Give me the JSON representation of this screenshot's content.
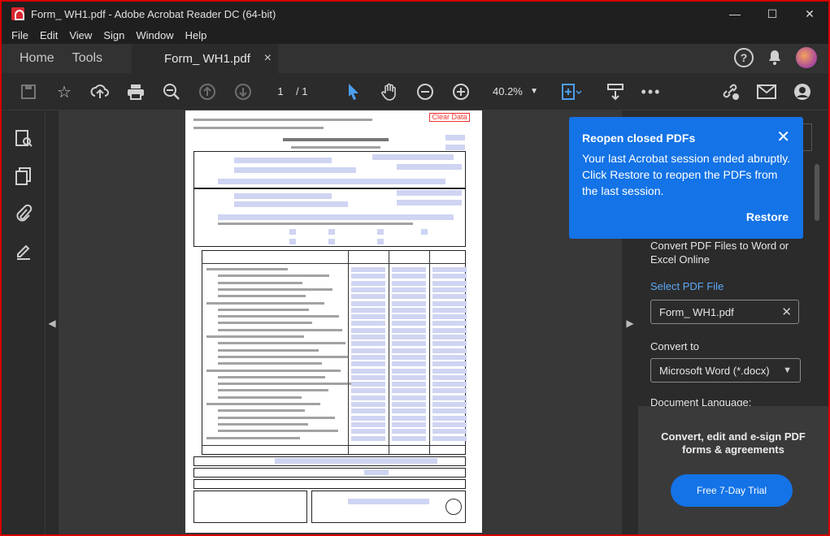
{
  "window": {
    "title": "Form_ WH1.pdf - Adobe Acrobat Reader DC (64-bit)",
    "min_glyph": "—",
    "max_glyph": "☐",
    "close_glyph": "✕"
  },
  "menu": [
    "File",
    "Edit",
    "View",
    "Sign",
    "Window",
    "Help"
  ],
  "tabs": {
    "home": "Home",
    "tools": "Tools",
    "document": "Form_ WH1.pdf",
    "close_glyph": "×"
  },
  "toolbar": {
    "page_current": "1",
    "page_total": "/ 1",
    "zoom": "40.2%"
  },
  "document": {
    "clear_button": "Clear Data"
  },
  "popup": {
    "heading": "Reopen closed PDFs",
    "body": "Your last Acrobat session ended abruptly. Click Restore to reopen the PDFs from the last session.",
    "restore": "Restore"
  },
  "right_panel": {
    "convert_desc": "Convert PDF Files to Word or Excel Online",
    "select_link": "Select PDF File",
    "selected_file": "Form_ WH1.pdf",
    "convert_to_label": "Convert to",
    "convert_to_value": "Microsoft Word (*.docx)",
    "doc_language_label": "Document Language:",
    "promo_text": "Convert, edit and e-sign PDF forms & agreements",
    "trial_button": "Free 7-Day Trial"
  },
  "icons": {
    "save": "save-icon",
    "bookmark": "star-icon",
    "upload": "cloud-upload-icon",
    "print": "print-icon",
    "search": "zoom-search-icon",
    "page_up": "arrow-up-circle-icon",
    "page_down": "arrow-down-circle-icon",
    "select": "cursor-arrow-icon",
    "hand": "hand-icon",
    "zoom_out": "zoom-out-icon",
    "zoom_in": "zoom-in-icon",
    "fit": "fit-page-icon",
    "scroll": "scroll-mode-icon",
    "more": "more-icon",
    "link": "share-link-icon",
    "mail": "mail-icon",
    "user": "add-user-icon"
  },
  "colors": {
    "accent": "#1473e6",
    "frame": "#d40000",
    "link": "#5ea8f5"
  }
}
